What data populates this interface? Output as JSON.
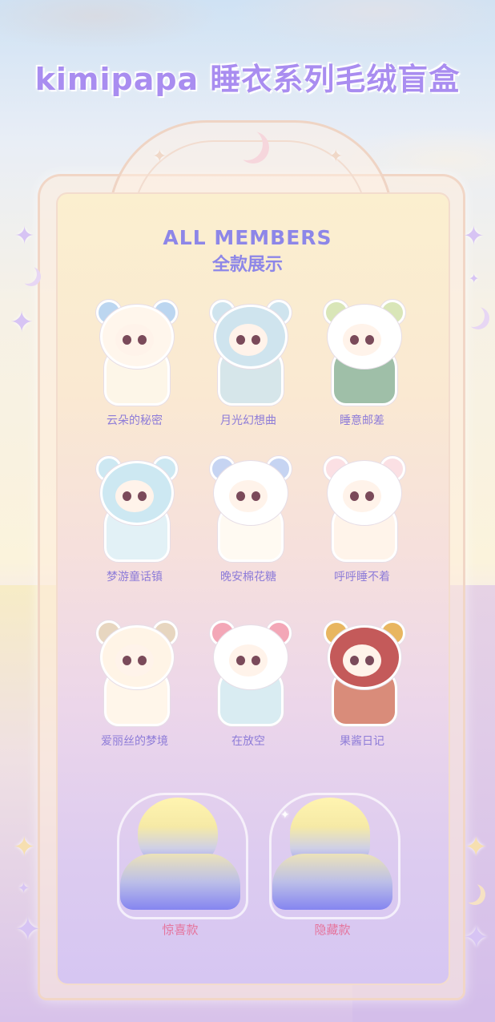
{
  "title": "kimipapa 睡衣系列毛绒盲盒",
  "heading": {
    "en": "ALL MEMBERS",
    "cn": "全款展示"
  },
  "members": [
    {
      "name": "云朵的秘密",
      "hood": "#fff6ec",
      "ear": "#bcd6f0",
      "body": "#fdf6e8"
    },
    {
      "name": "月光幻想曲",
      "hood": "#cfe4ee",
      "ear": "#cfe4ee",
      "body": "#d6e6ea"
    },
    {
      "name": "睡意邮差",
      "hood": "#ffffff",
      "ear": "#d9e6b8",
      "body": "#9fbfa8"
    },
    {
      "name": "梦游童话镇",
      "hood": "#cde8f2",
      "ear": "#cde8f2",
      "body": "#e2f1f6"
    },
    {
      "name": "晚安棉花糖",
      "hood": "#ffffff",
      "ear": "#c6d4f2",
      "body": "#fffaf2"
    },
    {
      "name": "呼呼睡不着",
      "hood": "#ffffff",
      "ear": "#fbe0e4",
      "body": "#fff4ea"
    },
    {
      "name": "爱丽丝的梦境",
      "hood": "#fff4e6",
      "ear": "#e7d6c0",
      "body": "#fff6ea"
    },
    {
      "name": "在放空",
      "hood": "#ffffff",
      "ear": "#f3a7b7",
      "body": "#d9ecf2"
    },
    {
      "name": "果酱日记",
      "hood": "#c45a5a",
      "ear": "#e8b660",
      "body": "#d98c7a"
    }
  ],
  "secrets": [
    {
      "name": "惊喜款"
    },
    {
      "name": "隐藏款"
    }
  ]
}
